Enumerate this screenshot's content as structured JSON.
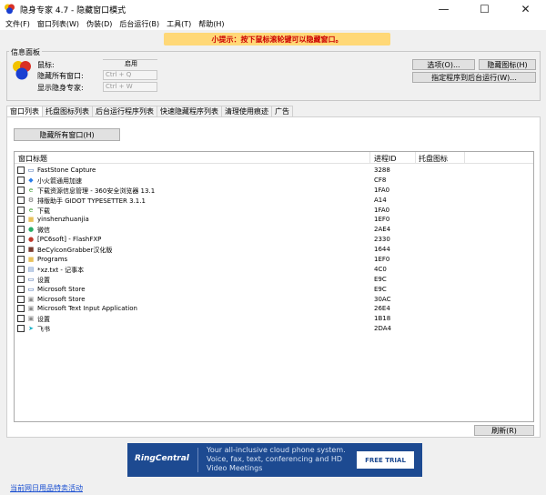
{
  "window": {
    "title": "隐身专家 4.7 - 隐藏窗口模式",
    "minimize_icon": "minimize-icon",
    "maximize_icon": "maximize-icon",
    "close_icon": "close-icon",
    "minimize_glyph": "—",
    "maximize_glyph": "☐",
    "close_glyph": "✕"
  },
  "menubar": {
    "items": [
      "文件(F)",
      "窗口列表(W)",
      "伪装(D)",
      "后台运行(B)",
      "工具(T)",
      "帮助(H)"
    ]
  },
  "tip": {
    "text": "小提示：按下鼠标滚轮键可以隐藏窗口。"
  },
  "info_panel": {
    "group_label": "信息面板",
    "mouse_label": "鼠标:",
    "mouse_status": "启用",
    "hide_all_label": "隐藏所有窗口:",
    "hide_all_hotkey": "Ctrl + Q",
    "show_expert_label": "显示隐身专家:",
    "show_expert_hotkey": "Ctrl + W",
    "options_button": "选项(O)...",
    "hide_icon_button": "隐藏图标(H)",
    "bg_run_button": "指定程序到后台运行(W)..."
  },
  "tabs": [
    "窗口列表",
    "托盘图标列表",
    "后台运行程序列表",
    "快速隐藏程序列表",
    "清理使用痕迹",
    "广告"
  ],
  "window_list": {
    "hide_all_button": "隐藏所有窗口(H)",
    "columns": [
      "窗口标题",
      "进程ID",
      "托盘图标"
    ],
    "rows": [
      {
        "title": "FastStone Capture",
        "pid": "3288",
        "icon": "window-icon",
        "glyph": "▭",
        "color": "#1f4fa0"
      },
      {
        "title": "小火箭通用加速",
        "pid": "CF8",
        "icon": "rocket-icon",
        "glyph": "◆",
        "color": "#2b7de9"
      },
      {
        "title": "下载资源信息管理 - 360安全浏览器 13.1",
        "pid": "1FA0",
        "icon": "browser-icon",
        "glyph": "e",
        "color": "#3a9b2f"
      },
      {
        "title": "排版助手 GIDOT TYPESETTER 3.1.1",
        "pid": "A14",
        "icon": "gear-icon",
        "glyph": "⚙",
        "color": "#666666"
      },
      {
        "title": "下载",
        "pid": "1FA0",
        "icon": "browser-icon",
        "glyph": "e",
        "color": "#3a9b2f"
      },
      {
        "title": "yinshenzhuanjia",
        "pid": "1EF0",
        "icon": "folder-icon",
        "glyph": "■",
        "color": "#e8c15a"
      },
      {
        "title": "微信",
        "pid": "2AE4",
        "icon": "chat-icon",
        "glyph": "●",
        "color": "#2aae67"
      },
      {
        "title": "[PC6soft] - FlashFXP",
        "pid": "2330",
        "icon": "flash-icon",
        "glyph": "●",
        "color": "#c0392b"
      },
      {
        "title": "BeCylconGrabber汉化版",
        "pid": "1644",
        "icon": "app-icon",
        "glyph": "■",
        "color": "#7a3b2e"
      },
      {
        "title": "Programs",
        "pid": "1EF0",
        "icon": "folder-icon",
        "glyph": "■",
        "color": "#e8c15a"
      },
      {
        "title": "*xz.txt - 记事本",
        "pid": "4C0",
        "icon": "notepad-icon",
        "glyph": "▤",
        "color": "#5b86c4"
      },
      {
        "title": "设置",
        "pid": "E9C",
        "icon": "window-icon",
        "glyph": "▭",
        "color": "#1f4fa0"
      },
      {
        "title": "Microsoft Store",
        "pid": "E9C",
        "icon": "window-icon",
        "glyph": "▭",
        "color": "#1f4fa0"
      },
      {
        "title": "Microsoft Store",
        "pid": "30AC",
        "icon": "store-icon",
        "glyph": "▣",
        "color": "#8a8a8a"
      },
      {
        "title": "Microsoft Text Input Application",
        "pid": "26E4",
        "icon": "app-icon",
        "glyph": "▣",
        "color": "#8a8a8a"
      },
      {
        "title": "设置",
        "pid": "1B18",
        "icon": "settings-icon",
        "glyph": "▣",
        "color": "#8a8a8a"
      },
      {
        "title": "飞书",
        "pid": "2DA4",
        "icon": "feishu-icon",
        "glyph": "➤",
        "color": "#18b2c8"
      }
    ],
    "refresh_button": "刷新(R)"
  },
  "ad": {
    "brand": "RingCentral",
    "text": "Your all-inclusive cloud phone system. Voice, fax, text, conferencing and HD Video Meetings",
    "cta": "FREE TRIAL"
  },
  "bottom_link": "当前网日用品特卖活动"
}
